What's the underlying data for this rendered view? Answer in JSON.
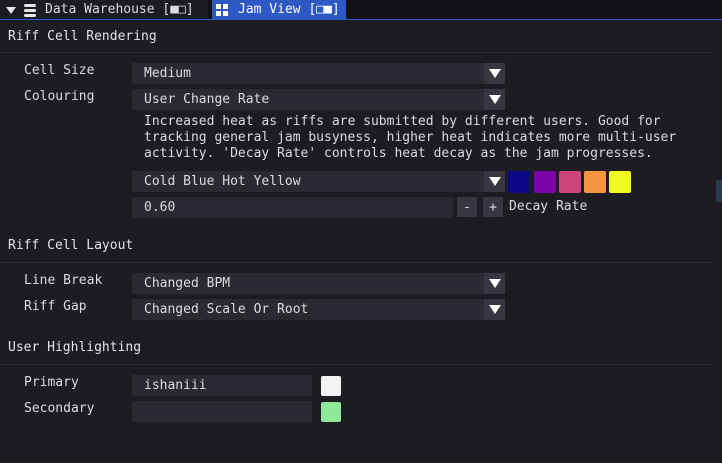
{
  "tabs": [
    {
      "label": "Data Warehouse [■□]",
      "icon": "database-icon",
      "active": false
    },
    {
      "label": "Jam View [□■]",
      "icon": "grid-icon",
      "active": true
    }
  ],
  "rendering": {
    "title": "Riff Cell Rendering",
    "cell_size_label": "Cell Size",
    "cell_size_value": "Medium",
    "colouring_label": "Colouring",
    "colouring_value": "User Change Rate",
    "description": "Increased heat as riffs are submitted by different users. Good for\ntracking general jam busyness, higher heat indicates more multi-user\nactivity. 'Decay Rate' controls heat decay as the jam progresses.",
    "palette_value": "Cold Blue Hot Yellow",
    "palette_colors": [
      "#0d0887",
      "#7e03a8",
      "#cc4778",
      "#f89540",
      "#f0f921"
    ],
    "decay_value": "0.60",
    "decay_minus": "-",
    "decay_plus": "+",
    "decay_label": "Decay Rate"
  },
  "layout": {
    "title": "Riff Cell Layout",
    "line_break_label": "Line Break",
    "line_break_value": "Changed BPM",
    "riff_gap_label": "Riff Gap",
    "riff_gap_value": "Changed Scale Or Root"
  },
  "highlighting": {
    "title": "User Highlighting",
    "primary_label": "Primary",
    "primary_value": "ishaniii",
    "primary_color": "#f2f2f2",
    "secondary_label": "Secondary",
    "secondary_value": "",
    "secondary_color": "#8de899"
  }
}
